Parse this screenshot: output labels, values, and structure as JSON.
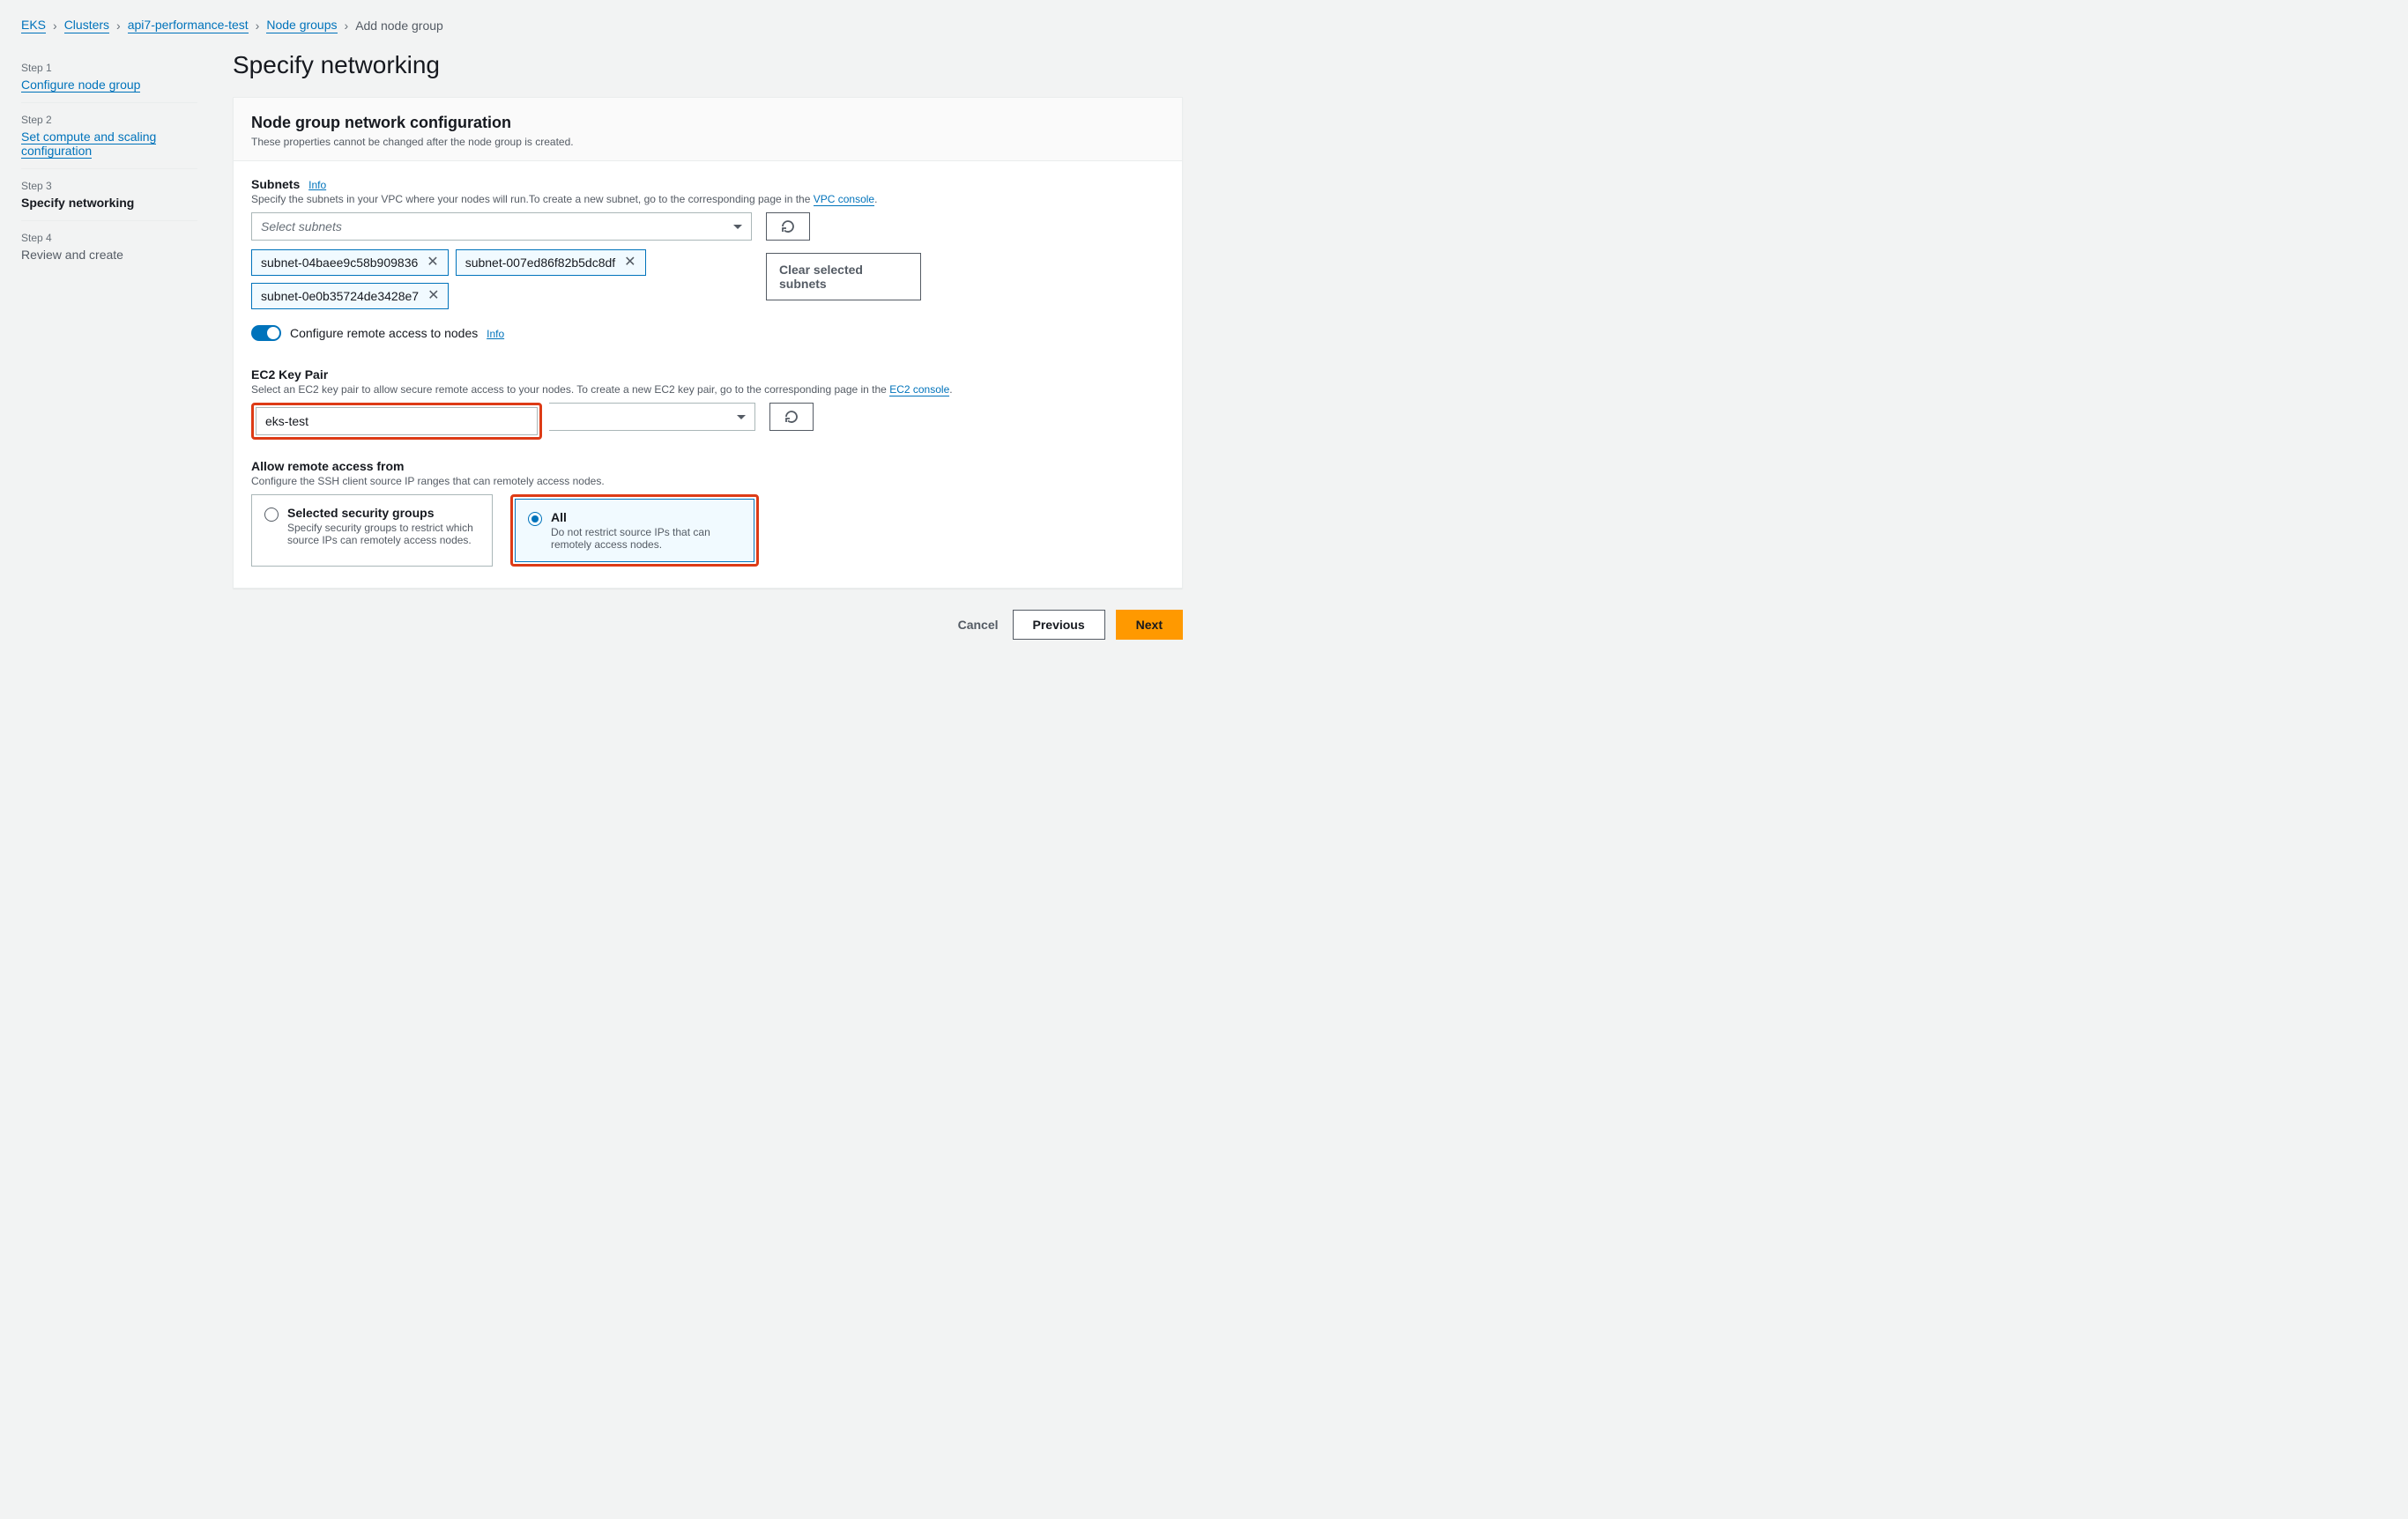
{
  "breadcrumb": {
    "items": [
      "EKS",
      "Clusters",
      "api7-performance-test",
      "Node groups"
    ],
    "current": "Add node group"
  },
  "steps": [
    {
      "num": "Step 1",
      "title": "Configure node group"
    },
    {
      "num": "Step 2",
      "title": "Set compute and scaling configuration"
    },
    {
      "num": "Step 3",
      "title": "Specify networking"
    },
    {
      "num": "Step 4",
      "title": "Review and create"
    }
  ],
  "pageTitle": "Specify networking",
  "panelHeader": {
    "title": "Node group network configuration",
    "desc": "These properties cannot be changed after the node group is created."
  },
  "subnets": {
    "label": "Subnets",
    "info": "Info",
    "hint_pre": "Specify the subnets in your VPC where your nodes will run.To create a new subnet, go to the corresponding page in the ",
    "hint_link": "VPC console",
    "hint_post": ".",
    "placeholder": "Select subnets",
    "tokens": [
      "subnet-04baee9c58b909836",
      "subnet-007ed86f82b5dc8df",
      "subnet-0e0b35724de3428e7"
    ],
    "clear": "Clear selected subnets"
  },
  "remoteToggle": {
    "label": "Configure remote access to nodes",
    "info": "Info"
  },
  "keypair": {
    "label": "EC2 Key Pair",
    "hint_pre": "Select an EC2 key pair to allow secure remote access to your nodes. To create a new EC2 key pair, go to the corresponding page in the ",
    "hint_link": "EC2 console",
    "hint_post": ".",
    "value": "eks-test"
  },
  "allowFrom": {
    "label": "Allow remote access from",
    "hint": "Configure the SSH client source IP ranges that can remotely access nodes.",
    "options": {
      "sg": {
        "title": "Selected security groups",
        "desc": "Specify security groups to restrict which source IPs can remotely access nodes."
      },
      "all": {
        "title": "All",
        "desc": "Do not restrict source IPs that can remotely access nodes."
      }
    }
  },
  "footer": {
    "cancel": "Cancel",
    "previous": "Previous",
    "next": "Next"
  }
}
